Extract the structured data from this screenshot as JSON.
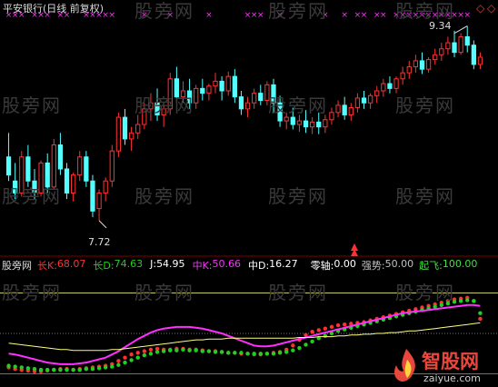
{
  "window": {
    "title": "平安银行(日线 前复权)"
  },
  "watermark": "股旁网",
  "price_panel": {
    "high_label": "9.34",
    "low_label": "7.72",
    "diamond_symbol": "◇",
    "marker_symbol": "×"
  },
  "indicator_legend": {
    "name": "股旁网",
    "items": [
      {
        "label": "长K:",
        "value": "68.07",
        "color": "#ff3030"
      },
      {
        "label": "长D:",
        "value": "74.63",
        "color": "#20d020"
      },
      {
        "label": "J:",
        "value": "54.95",
        "color": "#ffffff"
      },
      {
        "label": "中K:",
        "value": "50.66",
        "color": "#ff30ff"
      },
      {
        "label": "中D:",
        "value": "16.27",
        "color": "#ffffff"
      },
      {
        "label": "零轴:",
        "value": "0.00",
        "color": "#ffffff"
      },
      {
        "label": "强势:",
        "value": "50.00",
        "color": "#c0c0c0"
      },
      {
        "label": "起飞:",
        "value": "100.00",
        "color": "#40e040"
      }
    ]
  },
  "logo": {
    "text": "智股网",
    "url": "zaiyue.com"
  },
  "chart_data": {
    "type": "candlestick",
    "price": {
      "ylim": [
        7.5,
        9.45
      ],
      "candles": [
        [
          8.25,
          8.45,
          8.1,
          8.05
        ],
        [
          8.05,
          8.2,
          7.95,
          7.9
        ],
        [
          7.95,
          8.3,
          8.25,
          7.92
        ],
        [
          8.25,
          8.35,
          8.05,
          8.0
        ],
        [
          8.05,
          8.15,
          7.95,
          7.9
        ],
        [
          7.95,
          8.22,
          8.2,
          7.92
        ],
        [
          8.2,
          8.28,
          8.0,
          7.95
        ],
        [
          8.0,
          8.4,
          8.35,
          7.98
        ],
        [
          8.35,
          8.45,
          8.15,
          8.1
        ],
        [
          8.15,
          8.2,
          7.95,
          7.9
        ],
        [
          7.95,
          8.12,
          8.1,
          7.88
        ],
        [
          8.1,
          8.3,
          8.25,
          8.05
        ],
        [
          8.25,
          8.3,
          8.05,
          8.0
        ],
        [
          8.05,
          8.1,
          7.8,
          7.75
        ],
        [
          7.82,
          7.98,
          7.95,
          7.72
        ],
        [
          7.95,
          8.08,
          8.05,
          7.88
        ],
        [
          8.05,
          8.35,
          8.3,
          8.0
        ],
        [
          8.3,
          8.62,
          8.58,
          8.25
        ],
        [
          8.58,
          8.65,
          8.4,
          8.35
        ],
        [
          8.4,
          8.5,
          8.45,
          8.3
        ],
        [
          8.45,
          8.6,
          8.52,
          8.4
        ],
        [
          8.52,
          8.7,
          8.65,
          8.48
        ],
        [
          8.65,
          8.78,
          8.7,
          8.55
        ],
        [
          8.7,
          8.82,
          8.6,
          8.55
        ],
        [
          8.6,
          8.7,
          8.65,
          8.5
        ],
        [
          8.65,
          8.95,
          8.9,
          8.6
        ],
        [
          8.9,
          9.0,
          8.75,
          8.7
        ],
        [
          8.75,
          8.88,
          8.8,
          8.7
        ],
        [
          8.8,
          8.9,
          8.7,
          8.65
        ],
        [
          8.7,
          8.85,
          8.82,
          8.65
        ],
        [
          8.82,
          8.9,
          8.78,
          8.72
        ],
        [
          8.78,
          8.86,
          8.84,
          8.72
        ],
        [
          8.84,
          8.95,
          8.88,
          8.78
        ],
        [
          8.88,
          8.92,
          8.8,
          8.72
        ],
        [
          8.8,
          8.96,
          8.92,
          8.76
        ],
        [
          8.92,
          8.98,
          8.75,
          8.7
        ],
        [
          8.75,
          8.8,
          8.65,
          8.6
        ],
        [
          8.65,
          8.75,
          8.7,
          8.58
        ],
        [
          8.7,
          8.82,
          8.78,
          8.65
        ],
        [
          8.78,
          8.85,
          8.72,
          8.68
        ],
        [
          8.72,
          8.88,
          8.85,
          8.68
        ],
        [
          8.85,
          8.9,
          8.7,
          8.62
        ],
        [
          8.7,
          8.76,
          8.55,
          8.5
        ],
        [
          8.55,
          8.62,
          8.58,
          8.48
        ],
        [
          8.58,
          8.66,
          8.52,
          8.48
        ],
        [
          8.52,
          8.6,
          8.55,
          8.46
        ],
        [
          8.55,
          8.64,
          8.5,
          8.45
        ],
        [
          8.5,
          8.58,
          8.54,
          8.44
        ],
        [
          8.54,
          8.62,
          8.5,
          8.44
        ],
        [
          8.5,
          8.6,
          8.56,
          8.45
        ],
        [
          8.56,
          8.66,
          8.62,
          8.52
        ],
        [
          8.62,
          8.72,
          8.68,
          8.58
        ],
        [
          8.68,
          8.75,
          8.6,
          8.56
        ],
        [
          8.6,
          8.7,
          8.66,
          8.55
        ],
        [
          8.66,
          8.78,
          8.74,
          8.62
        ],
        [
          8.74,
          8.8,
          8.7,
          8.65
        ],
        [
          8.7,
          8.78,
          8.76,
          8.65
        ],
        [
          8.76,
          8.84,
          8.8,
          8.7
        ],
        [
          8.8,
          8.9,
          8.86,
          8.75
        ],
        [
          8.86,
          8.92,
          8.82,
          8.78
        ],
        [
          8.82,
          8.92,
          8.9,
          8.78
        ],
        [
          8.9,
          9.0,
          8.95,
          8.85
        ],
        [
          8.95,
          9.05,
          9.0,
          8.9
        ],
        [
          9.0,
          9.1,
          9.05,
          8.95
        ],
        [
          9.05,
          9.12,
          8.98,
          8.94
        ],
        [
          8.98,
          9.08,
          9.06,
          8.95
        ],
        [
          9.06,
          9.15,
          9.1,
          9.02
        ],
        [
          9.1,
          9.2,
          9.15,
          9.05
        ],
        [
          9.15,
          9.25,
          9.2,
          9.1
        ],
        [
          9.2,
          9.3,
          9.12,
          9.08
        ],
        [
          9.12,
          9.28,
          9.25,
          9.1
        ],
        [
          9.25,
          9.34,
          9.18,
          9.12
        ],
        [
          9.18,
          9.22,
          9.02,
          8.98
        ],
        [
          9.02,
          9.12,
          9.08,
          8.98
        ]
      ]
    },
    "indicator": {
      "ylim": [
        -5,
        105
      ],
      "levels": [
        {
          "name": "起飞",
          "value": 100.0
        },
        {
          "name": "强势",
          "value": 50.0
        },
        {
          "name": "零轴",
          "value": 0.0
        }
      ],
      "series": [
        {
          "name": "长K",
          "color": "#ff3030",
          "values": [
            8,
            6,
            5,
            4,
            3,
            3,
            4,
            5,
            6,
            6,
            5,
            6,
            7,
            8,
            9,
            10,
            12,
            16,
            20,
            24,
            26,
            28,
            30,
            31,
            30,
            30,
            31,
            31,
            30,
            30,
            29,
            28,
            28,
            27,
            26,
            26,
            25,
            25,
            24,
            24,
            25,
            26,
            27,
            30,
            35,
            42,
            48,
            52,
            54,
            56,
            58,
            60,
            61,
            62,
            63,
            64,
            66,
            68,
            70,
            72,
            74,
            76,
            78,
            80,
            82,
            84,
            86,
            88,
            90,
            92,
            93,
            94,
            90,
            68
          ]
        },
        {
          "name": "长D",
          "color": "#20d020",
          "values": [
            10,
            9,
            8,
            7,
            6,
            5,
            5,
            5,
            5,
            5,
            5,
            5,
            6,
            6,
            7,
            8,
            9,
            11,
            14,
            17,
            20,
            23,
            25,
            27,
            28,
            29,
            29,
            30,
            29,
            29,
            28,
            28,
            27,
            27,
            26,
            26,
            26,
            25,
            25,
            25,
            25,
            25,
            26,
            27,
            29,
            32,
            36,
            40,
            44,
            47,
            50,
            53,
            55,
            57,
            59,
            61,
            63,
            65,
            67,
            69,
            71,
            73,
            75,
            77,
            79,
            81,
            83,
            85,
            87,
            89,
            90,
            91,
            90,
            75
          ]
        },
        {
          "name": "中K",
          "color": "#ff30ff",
          "values": [
            25,
            24,
            22,
            20,
            18,
            16,
            14,
            13,
            12,
            12,
            12,
            13,
            14,
            16,
            18,
            20,
            24,
            28,
            33,
            38,
            43,
            47,
            51,
            54,
            56,
            57,
            58,
            58,
            58,
            57,
            56,
            54,
            52,
            50,
            47,
            44,
            41,
            38,
            35,
            34,
            34,
            35,
            37,
            39,
            41,
            43,
            45,
            47,
            49,
            51,
            53,
            55,
            57,
            59,
            61,
            63,
            65,
            67,
            69,
            71,
            73,
            75,
            76,
            77,
            78,
            79,
            80,
            81,
            82,
            83,
            84,
            85,
            85,
            84
          ]
        },
        {
          "name": "中D",
          "color": "#ffff80",
          "values": [
            38,
            37,
            36,
            35,
            34,
            33,
            32,
            31,
            30,
            30,
            29,
            29,
            29,
            29,
            29,
            29,
            30,
            30,
            31,
            32,
            33,
            34,
            35,
            36,
            37,
            38,
            39,
            40,
            41,
            42,
            42,
            43,
            43,
            43,
            44,
            44,
            44,
            44,
            44,
            44,
            44,
            44,
            44,
            44,
            44,
            45,
            45,
            45,
            46,
            46,
            46,
            47,
            47,
            48,
            48,
            49,
            49,
            50,
            50,
            51,
            51,
            52,
            53,
            53,
            54,
            55,
            56,
            57,
            58,
            59,
            60,
            61,
            62,
            63
          ]
        }
      ]
    }
  }
}
